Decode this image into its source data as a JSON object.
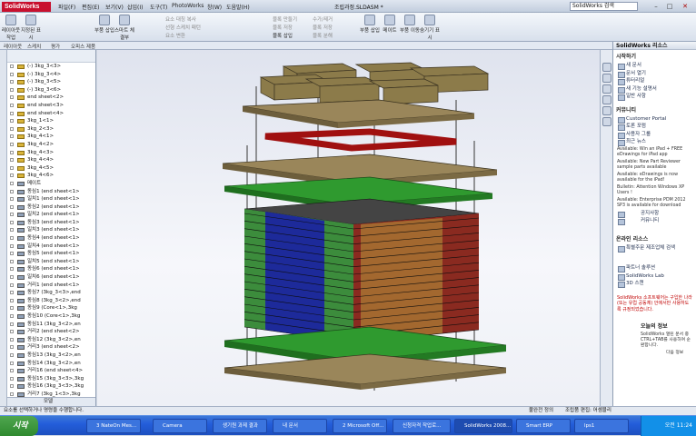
{
  "titlebar": {
    "logo": "SolidWorks",
    "menus": [
      "파일(F)",
      "편집(E)",
      "보기(V)",
      "삽입(I)",
      "도구(T)",
      "PhotoWorks",
      "창(W)",
      "도움말(H)"
    ],
    "document_title": "조립과정.SLDASM *",
    "search_placeholder": "SolidWorks 검색"
  },
  "toolbar": {
    "buttons": [
      "레이아웃 작업",
      "지정된 표시",
      "부품 삽입",
      "스마트 체결부",
      "삽입",
      "조립품 분해",
      "분해도",
      "메이트",
      "부품 이동"
    ],
    "greyed": [
      "블록 만들기",
      "블록 삽입",
      "수가/제거",
      "블록 저장",
      "블록 분해",
      "블록 저장",
      "요소 대칭 복사",
      "선형 스케치 패턴",
      "요소 변환"
    ],
    "right_buttons": [
      "부품 삽입",
      "메이트",
      "부품 이동",
      "숨기기 표시"
    ]
  },
  "command_tabs": [
    "레이아웃",
    "스케치",
    "평가",
    "오피스 제품"
  ],
  "feature_tree": {
    "items": [
      {
        "label": "(-) 3kg_3<3>",
        "type": "part"
      },
      {
        "label": "(-) 3kg_3<4>",
        "type": "part"
      },
      {
        "label": "(-) 3kg_3<5>",
        "type": "part"
      },
      {
        "label": "(-) 3kg_3<6>",
        "type": "part"
      },
      {
        "label": "end sheet<2>",
        "type": "part"
      },
      {
        "label": "end sheet<3>",
        "type": "part"
      },
      {
        "label": "end sheet<4>",
        "type": "part"
      },
      {
        "label": "3kg_1<1>",
        "type": "part"
      },
      {
        "label": "3kg_2<3>",
        "type": "part"
      },
      {
        "label": "3kg_4<1>",
        "type": "part"
      },
      {
        "label": "3kg_4<2>",
        "type": "part"
      },
      {
        "label": "3kg_4<3>",
        "type": "part"
      },
      {
        "label": "3kg_4<4>",
        "type": "part"
      },
      {
        "label": "3kg_4<5>",
        "type": "part"
      },
      {
        "label": "3kg_4<6>",
        "type": "part"
      },
      {
        "label": "메이트",
        "type": "mate"
      },
      {
        "label": "동심1 (end sheet<1>",
        "type": "mate"
      },
      {
        "label": "일치1 (end sheet<1>",
        "type": "mate"
      },
      {
        "label": "동심2 (end sheet<1>",
        "type": "mate"
      },
      {
        "label": "일치2 (end sheet<1>",
        "type": "mate"
      },
      {
        "label": "동심3 (end sheet<1>",
        "type": "mate"
      },
      {
        "label": "일치3 (end sheet<1>",
        "type": "mate"
      },
      {
        "label": "동심4 (end sheet<1>",
        "type": "mate"
      },
      {
        "label": "일치4 (end sheet<1>",
        "type": "mate"
      },
      {
        "label": "동심5 (end sheet<1>",
        "type": "mate"
      },
      {
        "label": "일치5 (end sheet<1>",
        "type": "mate"
      },
      {
        "label": "동심6 (end sheet<1>",
        "type": "mate"
      },
      {
        "label": "일치6 (end sheet<1>",
        "type": "mate"
      },
      {
        "label": "거리1 (end sheet<1>",
        "type": "mate"
      },
      {
        "label": "동심7 (3kg_3<3>,end",
        "type": "mate"
      },
      {
        "label": "동심8 (3kg_3<2>,end",
        "type": "mate"
      },
      {
        "label": "동심9 (Core<1>,3kg",
        "type": "mate"
      },
      {
        "label": "동심10 (Core<1>,3kg",
        "type": "mate"
      },
      {
        "label": "동심11 (3kg_3<2>,en",
        "type": "mate"
      },
      {
        "label": "거리2 (end sheet<2>",
        "type": "mate"
      },
      {
        "label": "동심12 (3kg_3<2>,en",
        "type": "mate"
      },
      {
        "label": "거리3 (end sheet<2>",
        "type": "mate"
      },
      {
        "label": "동심13 (3kg_3<2>,en",
        "type": "mate"
      },
      {
        "label": "동심14 (3kg_3<2>,en",
        "type": "mate"
      },
      {
        "label": "거리16 (end sheet<4>",
        "type": "mate"
      },
      {
        "label": "동심15 (3kg_3<3>,3kg",
        "type": "mate"
      },
      {
        "label": "동심16 (3kg_3<3>,3kg",
        "type": "mate"
      },
      {
        "label": "거리7 (3kg_1<3>,3kg",
        "type": "mate"
      }
    ],
    "bottom_tab": "모델"
  },
  "task_pane": {
    "title": "SolidWorks 리소스",
    "start_heading": "시작하기",
    "start_items": [
      "새 문서",
      "문서 열기",
      "튜터리얼",
      "새 기능 설명서",
      "일반 사항"
    ],
    "community_heading": "커뮤니티",
    "community_items": [
      "Customer Portal",
      "토론 포럼",
      "사용자 그룹",
      "최근 뉴스"
    ],
    "news": [
      "Available: Win an iPad + FREE eDrawings for iPad app",
      "Available: New Part Reviewer sample parts available",
      "Available: eDrawings is now available for the iPad!",
      "Bulletin: Attention Windows XP Users !",
      "Available: Enterprise PDM 2012 SP3 is available for download"
    ],
    "more_links": [
      "공지사항",
      "커뮤니티"
    ],
    "online_heading": "온라인 리소스",
    "online_items": [
      "특별주문 제조업체 검색",
      "파트너 솔루션",
      "SolidWorks Lab",
      "3D 스캔"
    ],
    "red_note": "SolidWorks 소프트웨어는 구입한 나라 (또는 유럽 공동체) 안에서만 사용하도록 규정되었습니다.",
    "tip_heading": "오늘의 정보",
    "tip_text": "SolidWorks 열린 문서 중 CTRL+TAB를 사용하여 순환합니다.",
    "tip_next": "다음 정보"
  },
  "status_bar": {
    "left": "요소를 선택하거나 명령을 수행합니다.",
    "right_1": "불완전 정의",
    "right_2": "조립품 편집: 어셈블리"
  },
  "taskbar": {
    "start": "시작",
    "items": [
      "3 NateOn Mes...",
      "Camera",
      "생기원 과제 결과",
      "내 문서",
      "2 Microsoft Off...",
      "신청자격 작업로...",
      "SolidWorks 2008...",
      "Smart ERP",
      "lps1"
    ],
    "clock": "오전 11:24"
  }
}
